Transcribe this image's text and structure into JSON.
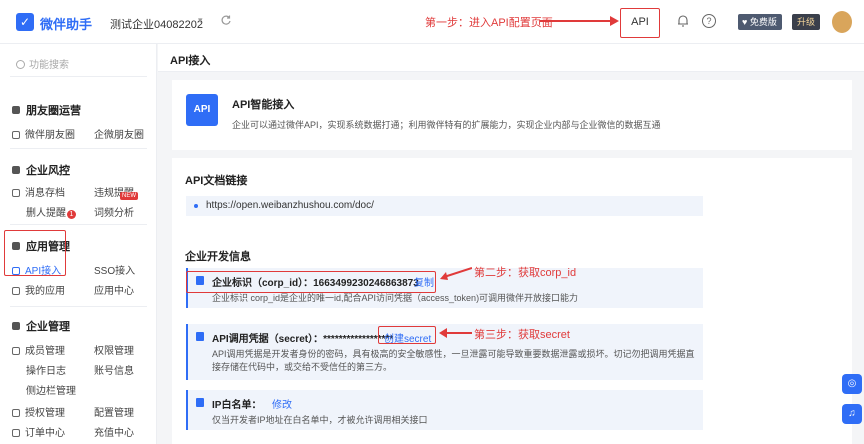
{
  "topbar": {
    "brand": "微伴助手",
    "company": "测试企业04082202",
    "step1_note": "第一步：进入API配置页面",
    "api_label": "API",
    "version_badge": "免费版",
    "upgrade_label": "升级"
  },
  "sidebar": {
    "search_placeholder": "功能搜索",
    "sections": {
      "moments": {
        "title": "朋友圈运营",
        "items": [
          "微伴朋友圈",
          "企微朋友圈"
        ]
      },
      "risk": {
        "title": "企业风控",
        "items": [
          "消息存档",
          "违规提醒",
          "删人提醒",
          "词频分析"
        ],
        "delete_count": "1",
        "new_badge": "NEW"
      },
      "app": {
        "title": "应用管理",
        "items": [
          "API接入",
          "SSO接入",
          "我的应用",
          "应用中心"
        ]
      },
      "company": {
        "title": "企业管理",
        "items": [
          "成员管理",
          "权限管理",
          "操作日志",
          "账号信息",
          "侧边栏管理",
          "授权管理",
          "配置管理",
          "订单中心",
          "充值中心"
        ]
      }
    }
  },
  "page": {
    "title": "API接入",
    "intro": {
      "logo": "API",
      "title": "API智能接入",
      "desc": "企业可以通过微伴API，实现系统数据打通；利用微伴特有的扩展能力，实现企业内部与企业微信的数据互通"
    },
    "docs": {
      "title": "API文档链接",
      "url": "https://open.weibanzhushou.com/doc/"
    },
    "dev": {
      "title": "企业开发信息",
      "corp_label": "企业标识（corp_id）：",
      "corp_value": "1663499230246863873",
      "copy_label": "复制",
      "corp_desc": "企业标识 corp_id是企业的唯一id,配合API访问凭据（access_token)可调用微伴开放接口能力",
      "secret_label": "API调用凭据（secret）：",
      "secret_value": "******************",
      "create_secret": "创建secret",
      "secret_desc": "API调用凭据是开发者身份的密码，具有极高的安全敏感性，一旦泄露可能导致重要数据泄露或损坏。切记勿把调用凭据直接存储在代码中，或交给不受信任的第三方。",
      "ip_label": "IP白名单：",
      "ip_edit": "修改",
      "ip_desc": "仅当开发者IP地址在白名单中，才被允许调用相关接口"
    },
    "notes": {
      "step2": "第二步：获取corp_id",
      "step3": "第三步：获取secret"
    }
  },
  "colors": {
    "accent": "#2f6df6",
    "annotation": "#e03a3a"
  }
}
